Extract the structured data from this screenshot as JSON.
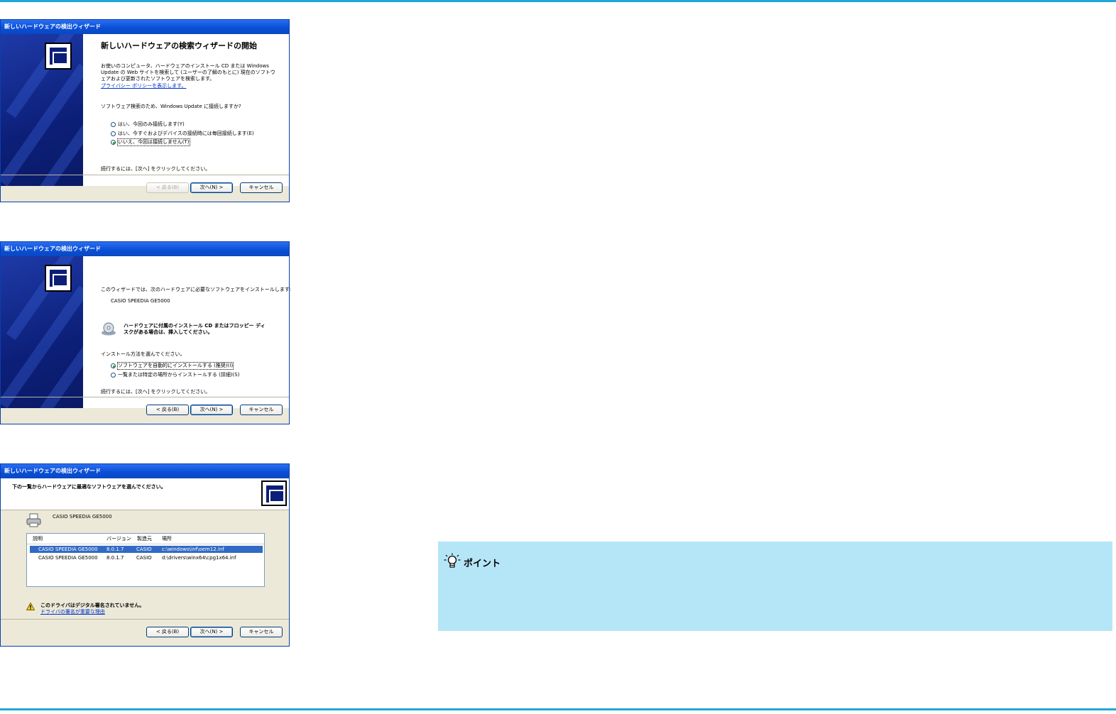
{
  "wizard1": {
    "title": "新しいハードウェアの検出ウィザード",
    "heading": "新しいハードウェアの検索ウィザードの開始",
    "intro_line1": "お使いのコンピュータ、ハードウェアのインストール CD または Windows",
    "intro_line2": "Update の Web サイトを検索して (ユーザーの了解のもとに) 現在のソフトウ",
    "intro_line3": "ェアおよび更新されたソフトウェアを検索します。",
    "privacy_link": "プライバシー ポリシーを表示します。",
    "question": "ソフトウェア検索のため、Windows Update に接続しますか?",
    "options": [
      {
        "label": "はい、今回のみ接続します(Y)",
        "selected": false
      },
      {
        "label": "はい、今すぐおよびデバイスの接続時には毎回接続します(E)",
        "selected": false
      },
      {
        "label": "いいえ、今回は接続しません(T)",
        "selected": true
      }
    ],
    "continue_text": "続行するには、[次へ] をクリックしてください。",
    "back_label": "< 戻る(B)",
    "next_label": "次へ(N) >",
    "cancel_label": "キャンセル"
  },
  "wizard2": {
    "title": "新しいハードウェアの検出ウィザード",
    "intro": "このウィザードでは、次のハードウェアに必要なソフトウェアをインストールします:",
    "device": "CASIO SPEEDIA GE5000",
    "cd_line1": "ハードウェアに付属のインストール CD またはフロッピー ディ",
    "cd_line2": "スクがある場合は、挿入してください。",
    "question": "インストール方法を選んでください。",
    "options": [
      {
        "label": "ソフトウェアを自動的にインストールする (推奨)(I)",
        "selected": true
      },
      {
        "label": "一覧または特定の場所からインストールする (詳細)(S)",
        "selected": false
      }
    ],
    "continue_text": "続行するには、[次へ] をクリックしてください。",
    "back_label": "< 戻る(B)",
    "next_label": "次へ(N) >",
    "cancel_label": "キャンセル"
  },
  "wizard3": {
    "title": "新しいハードウェアの検出ウィザード",
    "header": "下の一覧からハードウェアに最適なソフトウェアを選んでください。",
    "device": "CASIO SPEEDIA GE5000",
    "columns": [
      "説明",
      "バージョン",
      "製造元",
      "場所"
    ],
    "rows": [
      {
        "desc": "CASIO SPEEDIA GE5000",
        "version": "8.0.1.7",
        "maker": "CASIO",
        "location": "c:\\windows\\inf\\oem12.inf",
        "selected": true
      },
      {
        "desc": "CASIO SPEEDIA GE5000",
        "version": "8.0.1.7",
        "maker": "CASIO",
        "location": "d:\\drivers\\winx64\\cpg1x64.inf",
        "selected": false
      }
    ],
    "warning": "このドライバはデジタル署名されていません。",
    "warning_link": "ドライバの署名が重要な理由",
    "back_label": "< 戻る(B)",
    "next_label": "次へ(N) >",
    "cancel_label": "キャンセル"
  },
  "point": {
    "title": "ポイント"
  }
}
